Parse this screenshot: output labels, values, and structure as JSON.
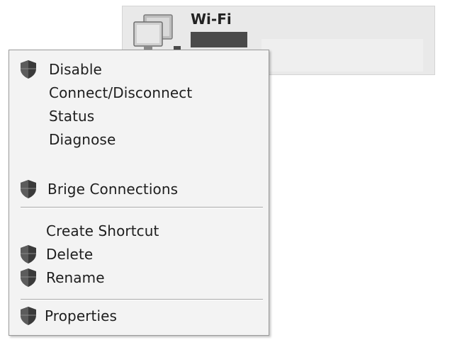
{
  "adapter": {
    "name": "Wi-Fi"
  },
  "context_menu": {
    "items": [
      {
        "label": "Disable",
        "has_shield": true
      },
      {
        "label": "Connect/Disconnect",
        "has_shield": false
      },
      {
        "label": "Status",
        "has_shield": false
      },
      {
        "label": "Diagnose",
        "has_shield": false
      },
      {
        "label": "Brige Connections",
        "has_shield": true
      },
      {
        "label": "Create Shortcut",
        "has_shield": false
      },
      {
        "label": "Delete",
        "has_shield": true
      },
      {
        "label": "Rename",
        "has_shield": true
      },
      {
        "label": "Properties",
        "has_shield": true
      }
    ],
    "icon": "uac-shield-icon"
  },
  "colors": {
    "menu_background": "#f3f3f3",
    "tile_background": "#e9e9e9",
    "shield_dark": "#3a3a3a"
  }
}
